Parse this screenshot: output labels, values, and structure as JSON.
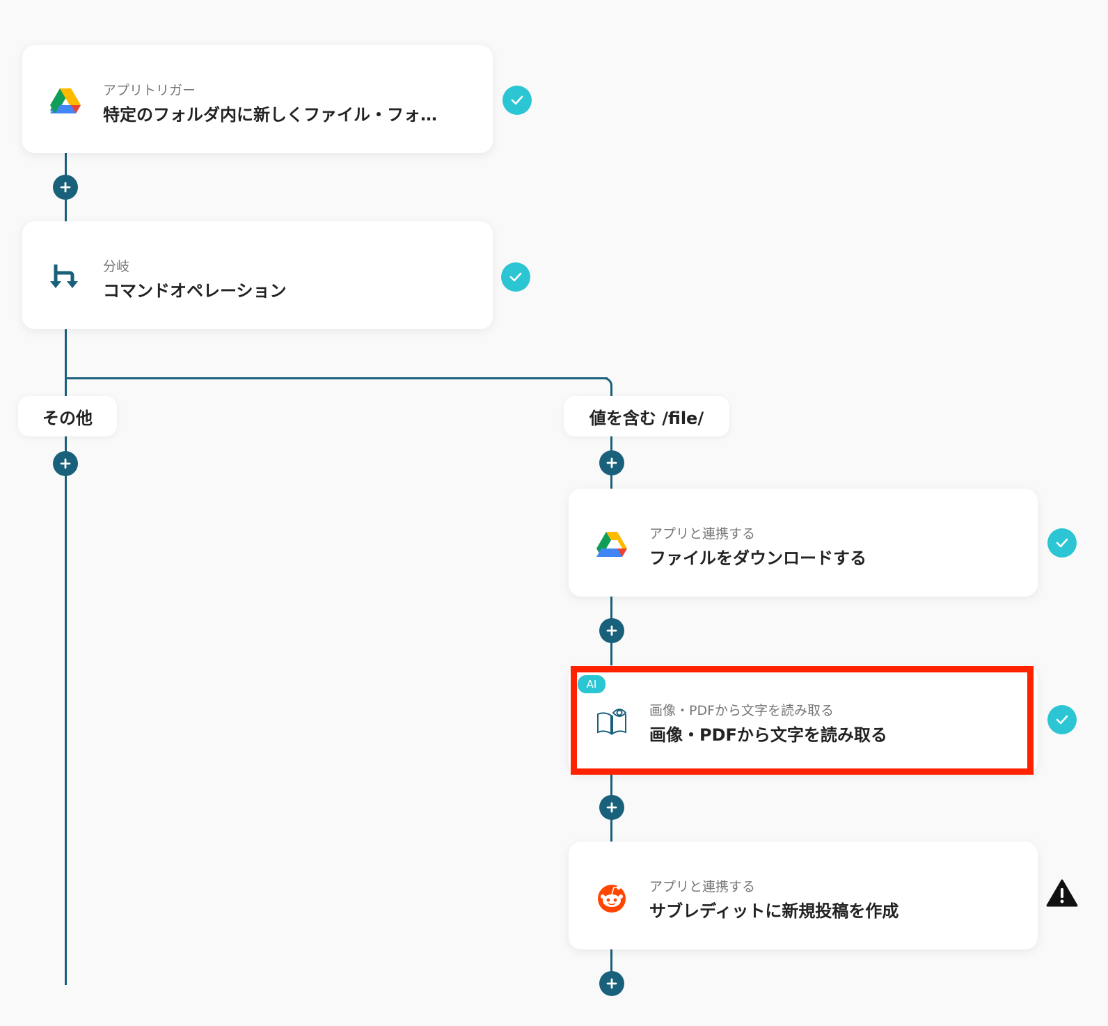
{
  "steps": [
    {
      "subtitle": "アプリトリガー",
      "title": "特定のフォルダ内に新しくファイル・フォ…",
      "icon": "google-drive-icon",
      "status": "complete"
    },
    {
      "subtitle": "分岐",
      "title": "コマンドオペレーション",
      "icon": "branch-icon",
      "status": "complete"
    },
    {
      "subtitle": "アプリと連携する",
      "title": "ファイルをダウンロードする",
      "icon": "google-drive-icon",
      "status": "complete"
    },
    {
      "subtitle": "画像・PDFから文字を読み取る",
      "title": "画像・PDFから文字を読み取る",
      "icon": "ocr-book-icon",
      "status": "complete",
      "badge": "AI"
    },
    {
      "subtitle": "アプリと連携する",
      "title": "サブレディットに新規投稿を作成",
      "icon": "reddit-icon",
      "status": "warning"
    }
  ],
  "branches": {
    "other_label": "その他",
    "match_label": "値を含む /file/"
  },
  "colors": {
    "connector": "#19607a",
    "check": "#2bc5d4",
    "highlight": "#ff2200"
  }
}
